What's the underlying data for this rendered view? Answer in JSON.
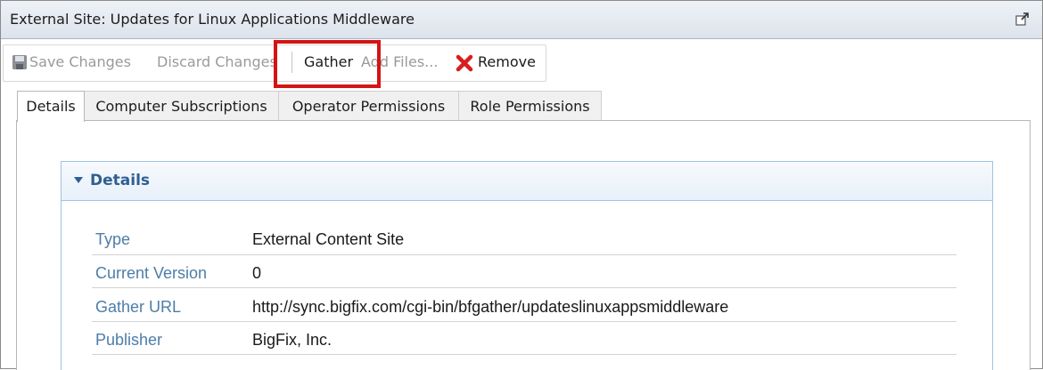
{
  "window": {
    "title": "External Site: Updates for Linux Applications Middleware",
    "popout_icon": "popout-icon"
  },
  "toolbar": {
    "save_label": "Save Changes",
    "discard_label": "Discard Changes",
    "gather_label": "Gather",
    "add_files_label": "Add Files...",
    "remove_label": "Remove",
    "save_icon": "save-icon",
    "remove_icon": "remove-x-icon",
    "highlight_color": "#d41414"
  },
  "tabs": [
    {
      "label": "Details",
      "active": true
    },
    {
      "label": "Computer Subscriptions",
      "active": false
    },
    {
      "label": "Operator Permissions",
      "active": false
    },
    {
      "label": "Role Permissions",
      "active": false
    }
  ],
  "details": {
    "section_title": "Details",
    "rows": [
      {
        "label": "Type",
        "value": "External Content Site"
      },
      {
        "label": "Current Version",
        "value": "0"
      },
      {
        "label": "Gather URL",
        "value": "http://sync.bigfix.com/cgi-bin/bfgather/updateslinuxappsmiddleware"
      },
      {
        "label": "Publisher",
        "value": "BigFix, Inc."
      }
    ]
  },
  "colors": {
    "accent": "#2f5f92",
    "label_color": "#4d7da8",
    "remove_red": "#d81e1e"
  }
}
